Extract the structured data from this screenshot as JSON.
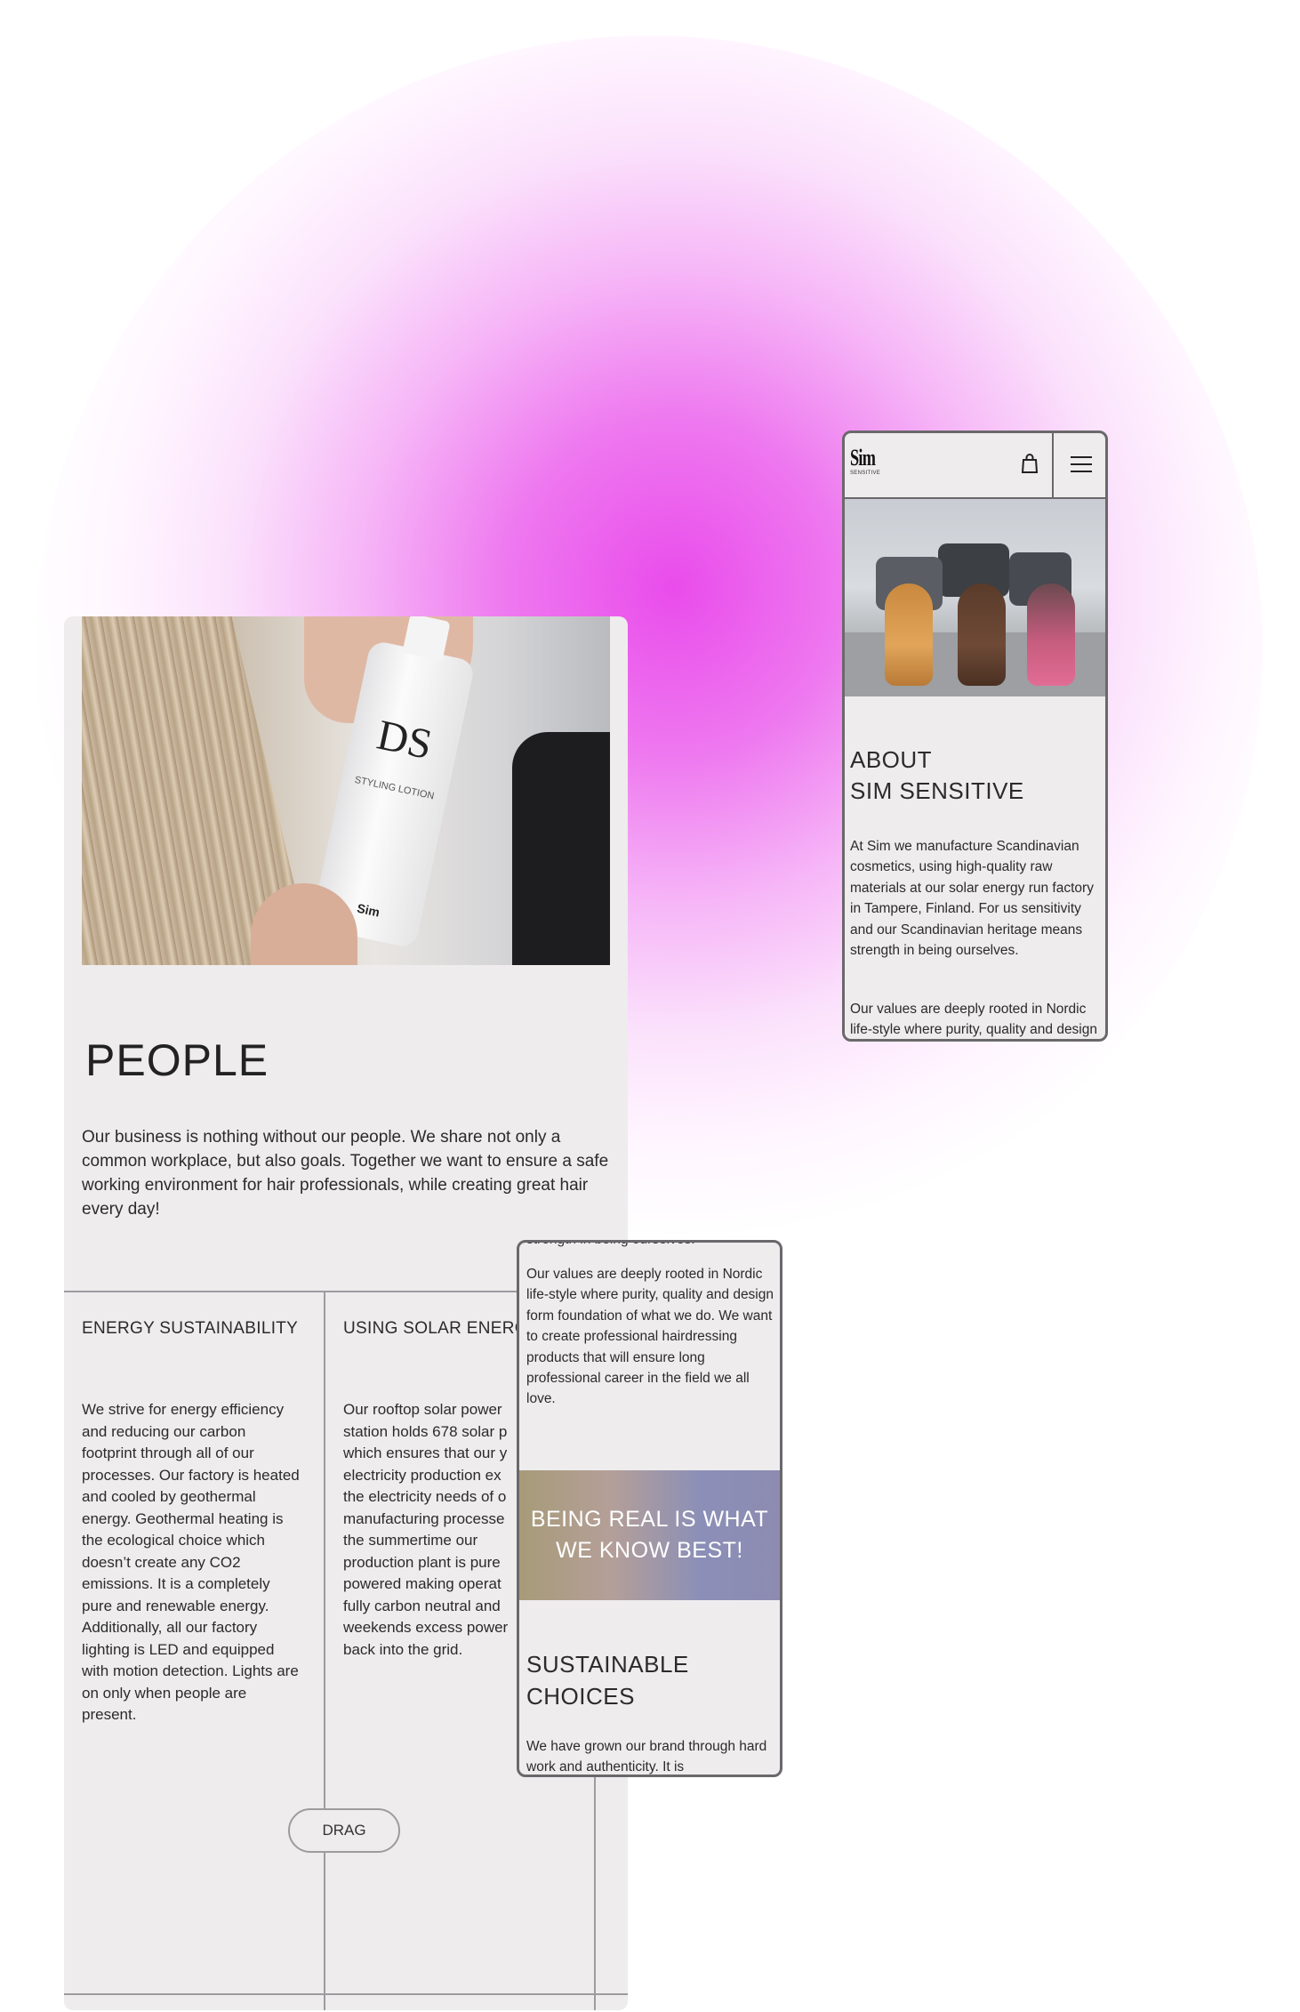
{
  "people_card": {
    "title": "PEOPLE",
    "intro": "Our business is nothing without our people. We share not only a common workplace, but also goals. Together we want to ensure a safe working environment for hair professionals, while creating great hair every day!",
    "photo": {
      "bottle_brand": "DS",
      "bottle_sub": "STYLING LOTION",
      "bottle_logo": "Sim"
    },
    "columns": [
      {
        "heading": "ENERGY SUSTAINABILITY",
        "text": "We strive for energy efficiency and reducing our carbon footprint through all of our processes. Our factory is heated and cooled by geothermal energy. Geothermal heating is the ecological choice which doesn’t create any CO2 emissions. It is a completely pure and renewable energy. Additionally, all our factory lighting is LED and equipped with motion detection. Lights are on only when people are present."
      },
      {
        "heading": "USING SOLAR ENERG",
        "text_lines": [
          "Our rooftop solar power",
          "station holds 678 solar p",
          "which ensures that our y",
          "electricity production ex",
          "the electricity needs of o",
          "manufacturing processe",
          "the summertime our",
          "production plant is pure",
          "powered making operat",
          "fully carbon neutral and",
          "weekends excess power",
          "back into the grid."
        ]
      }
    ],
    "drag_label": "DRAG"
  },
  "phone_about": {
    "logo": "Sim",
    "logo_sub": "SENSITIVE",
    "icons": [
      "shopping-bag-icon",
      "hamburger-menu-icon"
    ],
    "title_line1": "ABOUT",
    "title_line2": "SIM SENSITIVE",
    "para1": "At Sim we manufacture Scandinavian cosmetics, using high-quality raw materials at our solar energy run factory in Tampere, Finland. For us sensitivity and our Scandinavian heritage means strength in being ourselves.",
    "para2": "Our values are deeply rooted in Nordic life-style where purity, quality and design form foundation of what"
  },
  "phone_values": {
    "cut_text": "strength in being ourselves.",
    "para": "Our values are deeply rooted in Nordic life-style where purity, quality and design form foundation of what we do. We want to create professional hairdressing products that will ensure long professional career in the field we all love.",
    "banner": "BEING REAL IS WHAT WE KNOW BEST!",
    "title_line1": "SUSTAINABLE",
    "title_line2": "CHOICES",
    "para2": "We have grown our brand through hard work and authenticity. It is"
  },
  "colors": {
    "glow": "#e94ceb",
    "card_bg": "#eeeced",
    "frame": "#6a686b",
    "divider": "#9d9b9e"
  }
}
